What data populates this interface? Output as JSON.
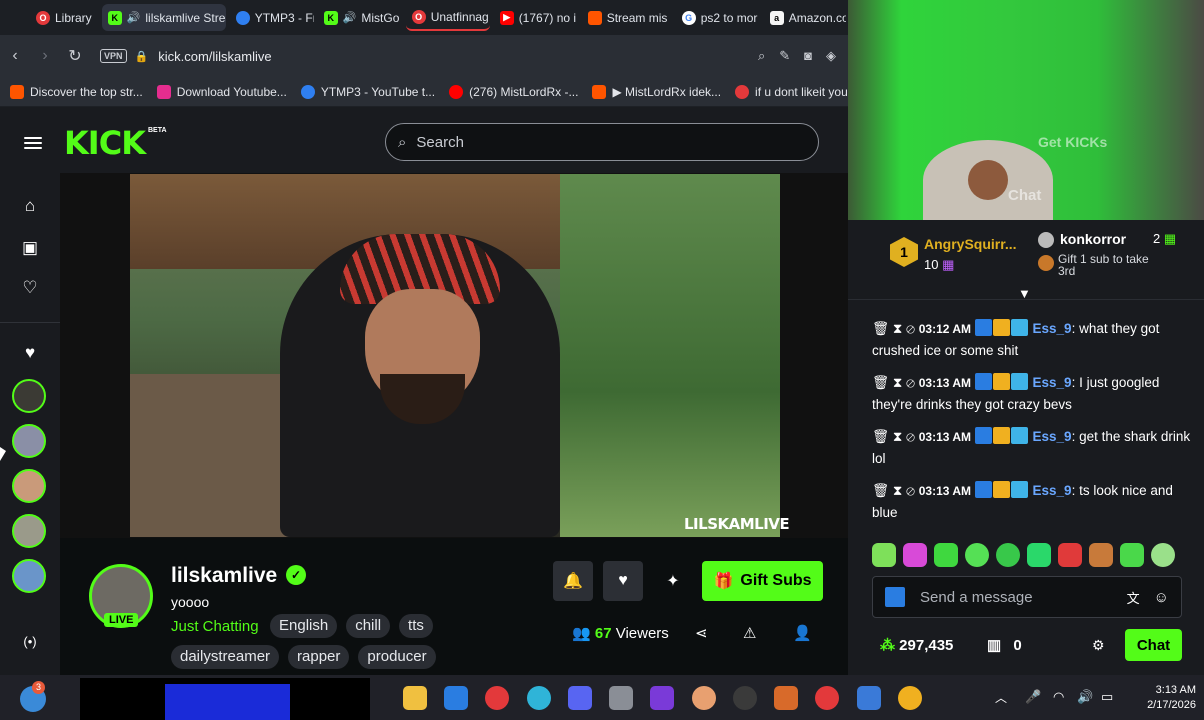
{
  "browser": {
    "tabs": [
      {
        "label": "Library",
        "icon": "opera-icon",
        "color": "#e3393b"
      },
      {
        "label": "lilskamlive Strea",
        "icon": "kick-icon",
        "color": "#53fc18",
        "active": true
      },
      {
        "label": "YTMP3 - Fr",
        "icon": "ytmp3-icon",
        "color": "#2f7ff0"
      },
      {
        "label": "MistGo",
        "icon": "kick-icon",
        "color": "#53fc18"
      },
      {
        "label": "Unatfinnag",
        "icon": "opera-icon",
        "color": "#e3393b"
      },
      {
        "label": "(1767) no i",
        "icon": "youtube-icon",
        "color": "#ff0000"
      },
      {
        "label": "Stream mis",
        "icon": "soundcloud-icon",
        "color": "#ff5500"
      },
      {
        "label": "ps2 to mor",
        "icon": "google-icon",
        "color": "#ffffff"
      },
      {
        "label": "Amazon.co",
        "icon": "amazon-icon",
        "color": "#f5f5f5"
      }
    ],
    "vpn_label": "VPN",
    "url": "kick.com/lilskamlive",
    "bookmarks": [
      {
        "label": "Discover the top str...",
        "color": "#ff5500"
      },
      {
        "label": "Download Youtube...",
        "color": "#e52d8f"
      },
      {
        "label": "YTMP3 - YouTube t...",
        "color": "#2f7ff0"
      },
      {
        "label": "(276) MistLordRx -...",
        "color": "#ff0000"
      },
      {
        "label": "▶ MistLordRx idek...",
        "color": "#ff5500"
      },
      {
        "label": "if u dont likeit you b...",
        "color": "#e3393b"
      }
    ]
  },
  "kick": {
    "logo": "KICK",
    "beta": "BETA",
    "search_placeholder": "Search",
    "watermark": "LILSKAMLIVE",
    "channel": {
      "name": "lilskamlive",
      "title": "yoooo",
      "live_badge": "LIVE",
      "category": "Just Chatting",
      "tags_row1": [
        "English",
        "chill",
        "tts"
      ],
      "tags_row2": [
        "dailystreamer",
        "rapper",
        "producer"
      ],
      "gift_subs_label": "Gift Subs",
      "viewers_count": "67",
      "viewers_label": "Viewers"
    }
  },
  "chat": {
    "top_overlay_labels": [
      "Get KICKs",
      "Chat"
    ],
    "leaderboard": {
      "first": {
        "rank": "1",
        "name": "AngrySquirr...",
        "points": "10"
      },
      "second": {
        "name": "konkorror",
        "points": "2"
      },
      "gift_note": "Gift 1 sub to take 3rd"
    },
    "messages": [
      {
        "time": "03:12 AM",
        "user": "Ess_9",
        "text": "what they got crushed ice or some shit"
      },
      {
        "time": "03:13 AM",
        "user": "Ess_9",
        "text": "I just googled they're drinks they got crazy bevs"
      },
      {
        "time": "03:13 AM",
        "user": "Ess_9",
        "text": "get the shark drink lol"
      },
      {
        "time": "03:13 AM",
        "user": "Ess_9",
        "text": "ts look nice and blue"
      }
    ],
    "input_placeholder": "Send a message",
    "points_total": "297,435",
    "gifts_count": "0",
    "chat_button": "Chat"
  },
  "taskbar": {
    "time": "3:13 AM",
    "date": "2/17/2026",
    "notification_badge": "3"
  },
  "colors": {
    "kick_green": "#53fc18",
    "chat_user": "#6aa7ff"
  }
}
